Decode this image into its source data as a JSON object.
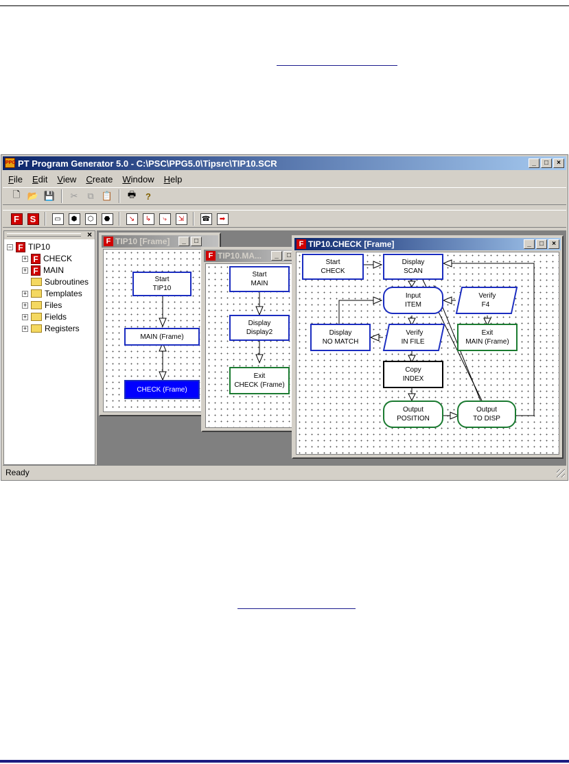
{
  "app": {
    "title": "PT Program Generator 5.0 - C:\\PSC\\PPG5.0\\Tipsrc\\TIP10.SCR",
    "icon_text": "PPG",
    "menus": [
      {
        "label": "File",
        "key": "F",
        "rest": "ile"
      },
      {
        "label": "Edit",
        "key": "E",
        "rest": "dit"
      },
      {
        "label": "View",
        "key": "V",
        "rest": "iew"
      },
      {
        "label": "Create",
        "key": "C",
        "rest": "reate"
      },
      {
        "label": "Window",
        "key": "W",
        "rest": "indow"
      },
      {
        "label": "Help",
        "key": "H",
        "rest": "elp"
      }
    ],
    "status": "Ready"
  },
  "tree": {
    "root": "TIP10",
    "items": [
      "CHECK",
      "MAIN",
      "Subroutines",
      "Templates",
      "Files",
      "Fields",
      "Registers"
    ],
    "close": "×"
  },
  "windows": {
    "tip10": {
      "title": "TIP10 [Frame]",
      "nodes": {
        "start": {
          "l1": "Start",
          "l2": "TIP10"
        },
        "main": {
          "l1": "MAIN (Frame)"
        },
        "check": {
          "l1": "CHECK (Frame)"
        }
      }
    },
    "main": {
      "title": "TIP10.MA...",
      "nodes": {
        "start": {
          "l1": "Start",
          "l2": "MAIN"
        },
        "display": {
          "l1": "Display",
          "l2": "Display2"
        },
        "exit": {
          "l1": "Exit",
          "l2": "CHECK (Frame)"
        }
      }
    },
    "check": {
      "title": "TIP10.CHECK [Frame]",
      "nodes": {
        "start": {
          "l1": "Start",
          "l2": "CHECK"
        },
        "display_scan": {
          "l1": "Display",
          "l2": "SCAN"
        },
        "input": {
          "l1": "Input",
          "l2": "ITEM"
        },
        "verify_f4": {
          "l1": "Verify",
          "l2": "F4"
        },
        "display_nomatch": {
          "l1": "Display",
          "l2": "NO MATCH"
        },
        "verify_infile": {
          "l1": "Verify",
          "l2": "IN FILE"
        },
        "exit_main": {
          "l1": "Exit",
          "l2": "MAIN (Frame)"
        },
        "copy": {
          "l1": "Copy",
          "l2": "INDEX"
        },
        "out_pos": {
          "l1": "Output",
          "l2": "POSITION"
        },
        "out_disp": {
          "l1": "Output",
          "l2": "TO DISP"
        }
      }
    }
  },
  "colors": {
    "node_blue": "#1a2cc0",
    "node_green": "#1a7a30",
    "selected_fill": "#0000ff",
    "title_active": "#0a246a"
  }
}
